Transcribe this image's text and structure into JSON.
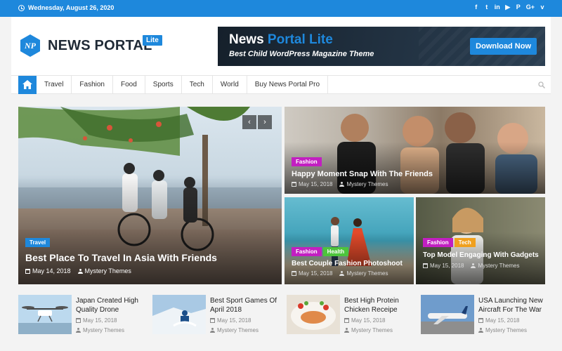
{
  "topbar": {
    "date": "Wednesday, August 26, 2020",
    "social_icons": [
      "facebook-icon",
      "twitter-icon",
      "linkedin-icon",
      "youtube-icon",
      "pinterest-icon",
      "google-plus-icon",
      "vimeo-icon"
    ],
    "social_glyphs": [
      "f",
      "t",
      "in",
      "▶",
      "P",
      "G+",
      "v"
    ]
  },
  "header": {
    "logo_mark": "NP",
    "logo_text": "NEWS PORTAL",
    "logo_badge": "Lite",
    "banner": {
      "title_main": "News",
      "title_highlight": "Portal Lite",
      "tagline": "Best Child WordPress Magazine Theme",
      "button": "Download Now"
    }
  },
  "nav": {
    "items": [
      "Travel",
      "Fashion",
      "Food",
      "Sports",
      "Tech",
      "World",
      "Buy News Portal Pro"
    ]
  },
  "featured": {
    "main": {
      "tags": [
        "Travel"
      ],
      "title": "Best Place To Travel In Asia With Friends",
      "date": "May 14, 2018",
      "author": "Mystery Themes"
    },
    "top_right": {
      "tags": [
        "Fashion"
      ],
      "title": "Happy Moment Snap With The Friends",
      "date": "May 15, 2018",
      "author": "Mystery Themes"
    },
    "bottom_left": {
      "tags": [
        "Fashion",
        "Health"
      ],
      "title": "Best Couple Fashion Photoshoot",
      "date": "May 15, 2018",
      "author": "Mystery Themes"
    },
    "bottom_right": {
      "tags": [
        "Fashion",
        "Tech"
      ],
      "title": "Top Model Engaging With Gadgets",
      "date": "May 15, 2018",
      "author": "Mystery Themes"
    },
    "slider_prev": "‹",
    "slider_next": "›"
  },
  "posts": [
    {
      "title": "Japan Created High Quality Drone",
      "date": "May 15, 2018",
      "author": "Mystery Themes"
    },
    {
      "title": "Best Sport Games Of April 2018",
      "date": "May 15, 2018",
      "author": "Mystery Themes"
    },
    {
      "title": "Best High Protein Chicken Receipe",
      "date": "May 15, 2018",
      "author": "Mystery Themes"
    },
    {
      "title": "USA Launching New Aircraft For The War",
      "date": "May 15, 2018",
      "author": "Mystery Themes"
    }
  ],
  "colors": {
    "accent": "#1e88dc",
    "tag_travel": "#1e88dc",
    "tag_fashion": "#c21fc1",
    "tag_health": "#4dc43c",
    "tag_tech": "#f0a01e"
  }
}
